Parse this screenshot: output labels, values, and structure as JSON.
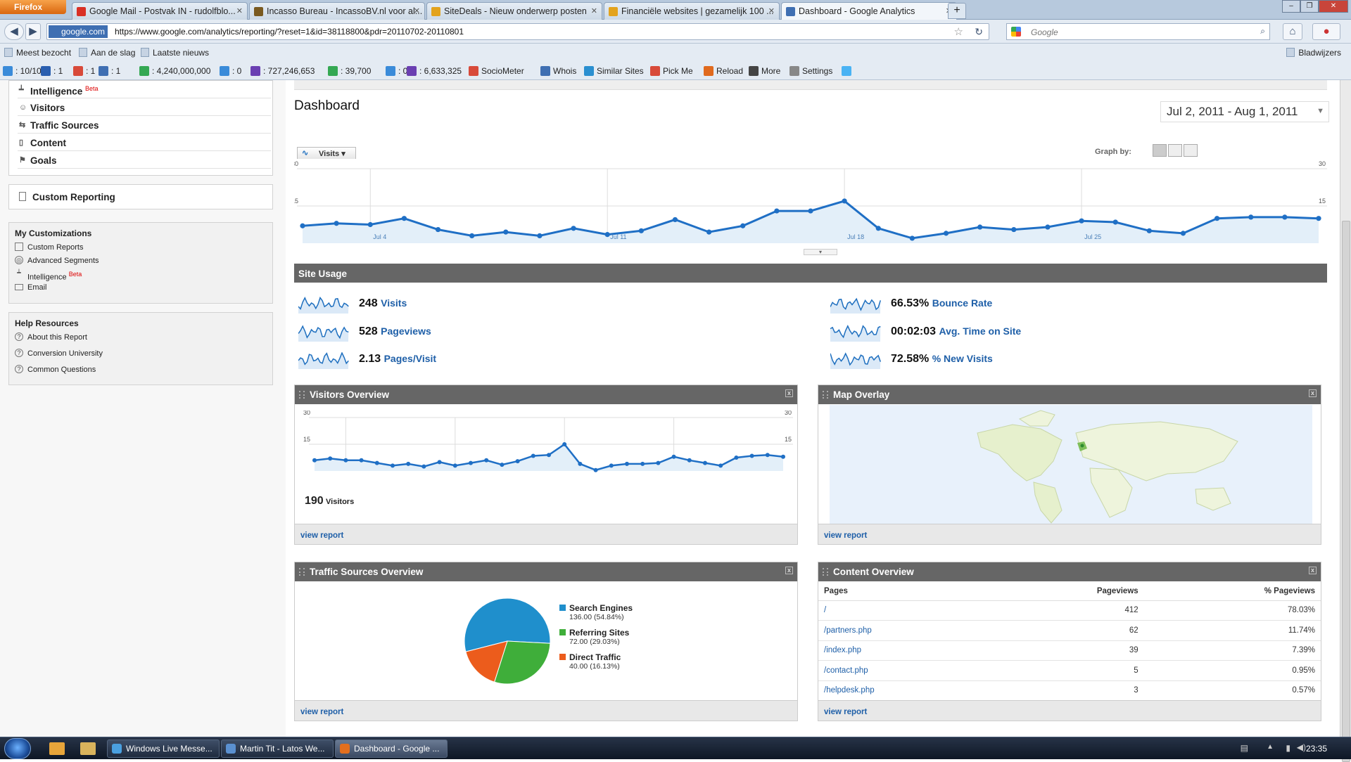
{
  "browser": {
    "menu_button": "Firefox",
    "tabs": [
      {
        "title": "Google Mail - Postvak IN - rudolfblo...",
        "color": "#d93025",
        "active": false
      },
      {
        "title": "Incasso Bureau - IncassoBV.nl voor al...",
        "color": "#7a5a20",
        "active": false
      },
      {
        "title": "SiteDeals - Nieuw onderwerp posten",
        "color": "#e3a31d",
        "active": false
      },
      {
        "title": "Financiële websites | gezamelijk 100 ...",
        "color": "#e3a31d",
        "active": false
      },
      {
        "title": "Dashboard - Google Analytics",
        "color": "#3f6fb2",
        "active": true
      }
    ],
    "url_site_label": "google.com",
    "url": "https://www.google.com/analytics/reporting/?reset=1&id=38118800&pdr=20110702-20110801",
    "search_placeholder": "Google",
    "bookmarks": [
      "Meest bezocht",
      "Aan de slag",
      "Laatste nieuws"
    ],
    "bookmarks_folder": "Bladwijzers",
    "seo_items": [
      ": 10/10",
      ": 1",
      ": 1",
      ": 1",
      ": 4,240,000,000",
      ": 0",
      ": 727,246,653",
      ": 39,700",
      ": 0",
      ": 6,633,325",
      "SocioMeter",
      "Whois",
      "Similar Sites",
      "Pick Me",
      "Reload",
      "More",
      "Settings"
    ]
  },
  "sidebar": {
    "nav": [
      {
        "label": "Intelligence",
        "beta": "Beta",
        "icon": "chart-icon"
      },
      {
        "label": "Visitors",
        "icon": "person-icon"
      },
      {
        "label": "Traffic Sources",
        "icon": "traffic-icon"
      },
      {
        "label": "Content",
        "icon": "page-icon"
      },
      {
        "label": "Goals",
        "icon": "flag-icon"
      }
    ],
    "custom_reporting": "Custom Reporting",
    "my_customizations": {
      "title": "My Customizations",
      "items": [
        "Custom Reports",
        "Advanced Segments",
        "Intelligence",
        "Email"
      ],
      "beta": "Beta"
    },
    "help": {
      "title": "Help Resources",
      "items": [
        "About this Report",
        "Conversion University",
        "Common Questions"
      ]
    }
  },
  "dashboard": {
    "title": "Dashboard",
    "date_range": "Jul 2, 2011 - Aug 1, 2011",
    "visits_button": "Visits",
    "graph_by": "Graph by:",
    "site_usage_title": "Site Usage",
    "metrics_left": [
      {
        "value": "248",
        "label": "Visits"
      },
      {
        "value": "528",
        "label": "Pageviews"
      },
      {
        "value": "2.13",
        "label": "Pages/Visit"
      }
    ],
    "metrics_right": [
      {
        "value": "66.53%",
        "label": "Bounce Rate"
      },
      {
        "value": "00:02:03",
        "label": "Avg. Time on Site"
      },
      {
        "value": "72.58%",
        "label": "% New Visits"
      }
    ],
    "visitors_overview": {
      "title": "Visitors Overview",
      "count": "190",
      "count_label": "Visitors",
      "view_report": "view report"
    },
    "map_overlay": {
      "title": "Map Overlay",
      "view_report": "view report"
    },
    "traffic_sources": {
      "title": "Traffic Sources Overview",
      "view_report": "view report"
    },
    "content_overview": {
      "title": "Content Overview",
      "columns": [
        "Pages",
        "Pageviews",
        "% Pageviews"
      ],
      "rows": [
        [
          "/",
          "412",
          "78.03%"
        ],
        [
          "/partners.php",
          "62",
          "11.74%"
        ],
        [
          "/index.php",
          "39",
          "7.39%"
        ],
        [
          "/contact.php",
          "5",
          "0.95%"
        ],
        [
          "/helpdesk.php",
          "3",
          "0.57%"
        ]
      ],
      "view_report": "view report"
    }
  },
  "chart_data": [
    {
      "type": "area",
      "x_tick_labels": [
        "Jul 4",
        "Jul 11",
        "Jul 18",
        "Jul 25"
      ],
      "y_tick_labels": [
        "30",
        "15"
      ],
      "ylim": [
        0,
        30
      ],
      "series": [
        {
          "values": [
            7,
            8,
            7.5,
            10,
            5.5,
            3,
            4.5,
            3,
            6,
            3.5,
            5,
            9.5,
            4.5,
            7,
            13,
            13,
            17,
            6,
            2,
            4,
            6.5,
            5.5,
            6.5,
            9,
            8.5,
            5,
            4,
            10,
            10.5,
            10.5,
            10
          ]
        }
      ]
    },
    {
      "type": "area",
      "y_tick_labels": [
        "30",
        "15"
      ],
      "ylim": [
        0,
        30
      ],
      "series": [
        {
          "values": [
            6,
            7,
            6,
            6,
            4.5,
            3,
            4,
            2.5,
            5,
            3,
            4.5,
            6,
            3.5,
            5.5,
            8.5,
            9,
            15,
            4,
            0.5,
            3,
            4,
            4,
            4.5,
            8,
            6,
            4.5,
            3,
            7.5,
            8.5,
            9,
            8
          ]
        }
      ]
    },
    {
      "type": "pie",
      "slices": [
        {
          "label": "Search Engines",
          "value": "136.00 (54.84%)",
          "percent": 54.84,
          "color": "#1f8fcc"
        },
        {
          "label": "Referring Sites",
          "value": "72.00 (29.03%)",
          "percent": 29.03,
          "color": "#3fae3a"
        },
        {
          "label": "Direct Traffic",
          "value": "40.00 (16.13%)",
          "percent": 16.13,
          "color": "#ec5c1c"
        }
      ]
    }
  ],
  "taskbar": {
    "tasks": [
      {
        "label": "Windows Live Messe...",
        "color": "#4aa0e0",
        "active": false
      },
      {
        "label": "Martin Tit - Latos We...",
        "color": "#5a90d0",
        "active": false
      },
      {
        "label": "Dashboard - Google ...",
        "color": "#e36f1e",
        "active": true
      }
    ],
    "clock": "23:35"
  }
}
